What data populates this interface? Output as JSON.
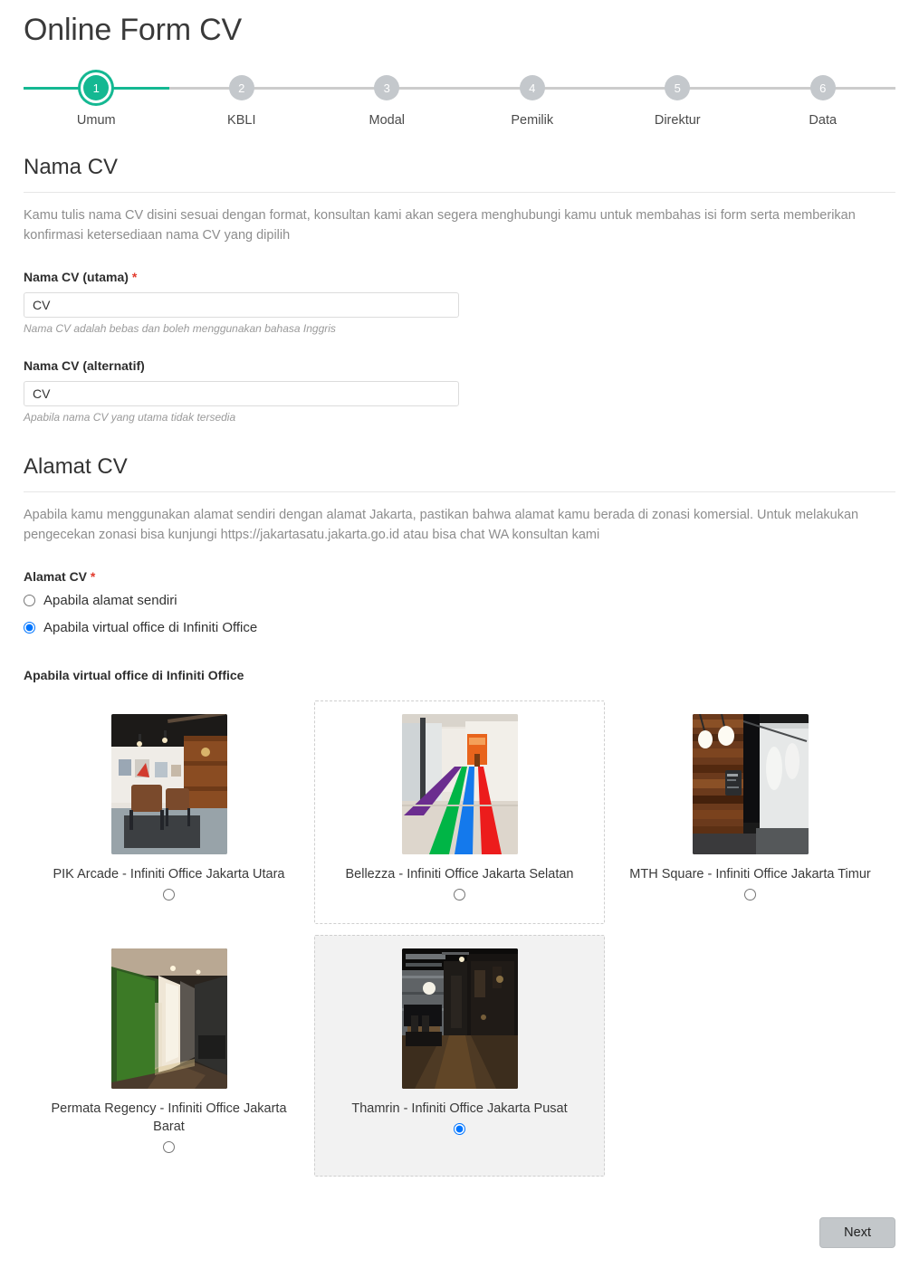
{
  "header": {
    "title": "Online Form CV"
  },
  "stepper": {
    "steps": [
      {
        "number": "1",
        "label": "Umum",
        "state": "active"
      },
      {
        "number": "2",
        "label": "KBLI",
        "state": "inactive"
      },
      {
        "number": "3",
        "label": "Modal",
        "state": "inactive"
      },
      {
        "number": "4",
        "label": "Pemilik",
        "state": "inactive"
      },
      {
        "number": "5",
        "label": "Direktur",
        "state": "inactive"
      },
      {
        "number": "6",
        "label": "Data",
        "state": "inactive"
      }
    ],
    "active_color": "#14b892",
    "inactive_color": "#c4c8cc"
  },
  "sections": {
    "nama_cv": {
      "title": "Nama CV",
      "description": "Kamu tulis nama CV disini sesuai dengan format, konsultan kami akan segera menghubungi kamu untuk membahas isi form serta memberikan konfirmasi ketersediaan nama CV yang dipilih",
      "fields": [
        {
          "label": "Nama CV (utama)",
          "required_marker": "*",
          "value": "CV",
          "placeholder": "",
          "hint": "Nama CV adalah bebas dan boleh menggunakan bahasa Inggris"
        },
        {
          "label": "Nama CV (alternatif)",
          "required_marker": "",
          "value": "CV",
          "placeholder": "",
          "hint": "Apabila nama CV yang utama tidak tersedia"
        }
      ]
    },
    "alamat_cv": {
      "title": "Alamat CV",
      "description": "Apabila kamu menggunakan alamat sendiri dengan alamat Jakarta, pastikan bahwa alamat kamu berada di zonasi komersial. Untuk melakukan pengecekan zonasi bisa kunjungi https://jakartasatu.jakarta.go.id atau bisa chat WA konsultan kami",
      "field_label": "Alamat CV",
      "required_marker": "*",
      "options": [
        {
          "label": "Apabila alamat sendiri",
          "selected": false
        },
        {
          "label": "Apabila virtual office di Infiniti Office",
          "selected": true
        }
      ],
      "sub_label": "Apabila virtual office di Infiniti Office",
      "offices": [
        {
          "name": "PIK Arcade - Infiniti Office Jakarta Utara",
          "selected": false,
          "state": "normal"
        },
        {
          "name": "Bellezza - Infiniti Office Jakarta Selatan",
          "selected": false,
          "state": "hovered"
        },
        {
          "name": "MTH Square - Infiniti Office Jakarta Timur",
          "selected": false,
          "state": "normal"
        },
        {
          "name": "Permata Regency - Infiniti Office Jakarta Barat",
          "selected": false,
          "state": "normal"
        },
        {
          "name": "Thamrin - Infiniti Office Jakarta Pusat",
          "selected": true,
          "state": "selected"
        }
      ]
    }
  },
  "footer": {
    "next_label": "Next"
  },
  "colors": {
    "accent_green": "#14b892",
    "required_red": "#e23b2e",
    "radio_blue": "#1064d8",
    "selected_card_bg": "#f2f2f2"
  }
}
